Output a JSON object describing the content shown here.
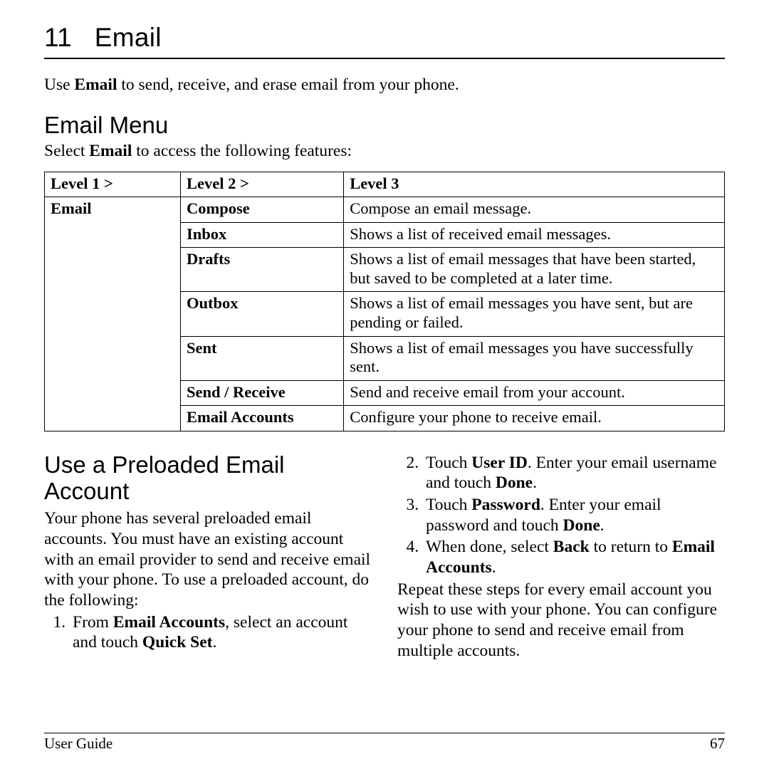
{
  "chapter": {
    "number": "11",
    "title": "Email"
  },
  "intro": {
    "pre": "Use ",
    "bold": "Email",
    "post": " to send, receive, and erase email from your phone."
  },
  "menu_section": {
    "title": "Email Menu",
    "lead_pre": "Select ",
    "lead_bold": "Email",
    "lead_post": " to access the following features:"
  },
  "table": {
    "headers": {
      "l1": "Level 1 >",
      "l2": "Level 2 >",
      "l3": "Level 3"
    },
    "l1_value": "Email",
    "rows": [
      {
        "l2": "Compose",
        "l3": "Compose an email message."
      },
      {
        "l2": "Inbox",
        "l3": "Shows a list of received email messages."
      },
      {
        "l2": "Drafts",
        "l3": "Shows a list of email messages that have been started, but saved to be completed at a later time."
      },
      {
        "l2": "Outbox",
        "l3": "Shows a list of email messages you have sent, but are pending or failed."
      },
      {
        "l2": "Sent",
        "l3": "Shows a list of email messages you have successfully sent."
      },
      {
        "l2": "Send / Receive",
        "l3": "Send and receive email from your account."
      },
      {
        "l2": "Email Accounts",
        "l3": "Configure your phone to receive email."
      }
    ]
  },
  "preload_section": {
    "title": "Use a Preloaded Email Account",
    "body": "Your phone has several preloaded email accounts. You must have an existing account with an email provider to send and receive email with your phone. To use a preloaded account, do the following:",
    "step1_pre": "From ",
    "step1_b1": "Email Accounts",
    "step1_mid": ", select an account and touch ",
    "step1_b2": "Quick Set",
    "step1_post": ".",
    "step2_pre": "Touch ",
    "step2_b1": "User ID",
    "step2_mid": ". Enter your email username and touch ",
    "step2_b2": "Done",
    "step2_post": ".",
    "step3_pre": "Touch ",
    "step3_b1": "Password",
    "step3_mid": ". Enter your email password and touch ",
    "step3_b2": "Done",
    "step3_post": ".",
    "step4_pre": "When done, select ",
    "step4_b1": "Back",
    "step4_mid": " to return to ",
    "step4_b2": "Email Accounts",
    "step4_post": ".",
    "closing": "Repeat these steps for every email account you wish to use with your phone. You can configure your phone to send and receive email from multiple accounts."
  },
  "footer": {
    "left": "User Guide",
    "right": "67"
  }
}
